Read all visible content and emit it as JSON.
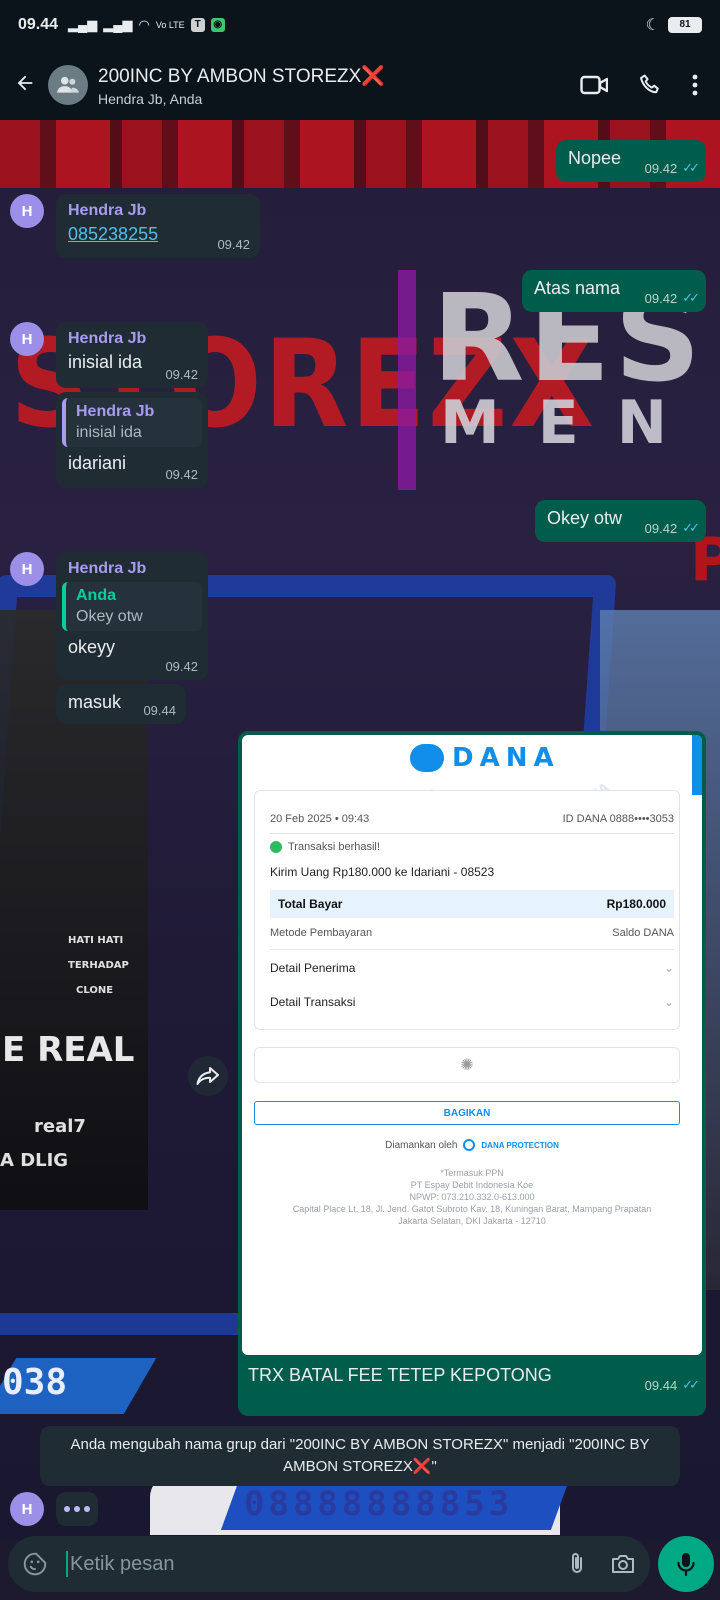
{
  "status_bar": {
    "time": "09.44",
    "network_label": "Vo LTE",
    "battery": "81"
  },
  "header": {
    "title": "200INC BY AMBON STOREZX",
    "title_suffix": "❌",
    "subtitle": "Hendra Jb, Anda"
  },
  "wallpaper": {
    "text_a": "STOREZX",
    "text_b": "RES",
    "text_c": "MEN",
    "photo_caption": "E REAL",
    "photo_small_1": "HATI HATI",
    "photo_small_2": "TERHADAP",
    "photo_small_3": "CLONE",
    "photo_small_4": "real7",
    "photo_small_5": "A DLIG",
    "number_a": "038",
    "number_b": "08888888853",
    "p_letter": "P"
  },
  "messages": {
    "m1": {
      "text": "Nopee",
      "time": "09.42"
    },
    "m2": {
      "sender": "Hendra Jb",
      "link": "085238255",
      "time": "09.42"
    },
    "m3": {
      "text": "Atas nama",
      "time": "09.42"
    },
    "m4": {
      "sender": "Hendra Jb",
      "text": "inisial ida",
      "time": "09.42"
    },
    "m5": {
      "quote_name": "Hendra Jb",
      "quote_text": "inisial ida",
      "text": "idariani",
      "time": "09.42"
    },
    "m6": {
      "text": "Okey otw",
      "time": "09.42"
    },
    "m7": {
      "sender": "Hendra Jb",
      "quote_name": "Anda",
      "quote_text": "Okey otw",
      "text": "okeyy",
      "time": "09.42"
    },
    "m8": {
      "text": "masuk",
      "time": "09.44"
    },
    "m9": {
      "caption": "TRX BATAL FEE TETEP KEPOTONG",
      "time": "09.44"
    }
  },
  "receipt": {
    "brand": "DANA",
    "date": "20 Feb 2025 • 09:43",
    "dana_id": "ID DANA 0888••••3053",
    "status": "Transaksi berhasil!",
    "description": "Kirim Uang Rp180.000 ke Idariani - 08523",
    "total_label": "Total Bayar",
    "total_value": "Rp180.000",
    "method_label": "Metode Pembayaran",
    "method_value": "Saldo DANA",
    "detail_receiver": "Detail Penerima",
    "detail_transaction": "Detail Transaksi",
    "share_label": "BAGIKAN",
    "secured_by": "Diamankan oleh",
    "protection": "DANA PROTECTION",
    "footer_1": "*Termasuk PPN",
    "footer_2": "PT Espay Debit Indonesia Koe",
    "footer_3": "NPWP: 073.210.332.0-613.000",
    "footer_4": "Capital Place Lt. 18, Jl. Jend. Gatot Subroto Kav. 18, Kuningan Barat, Mampang Prapatan",
    "footer_5": "Jakarta Selatan, DKI Jakarta - 12710",
    "watermark": "DANA"
  },
  "system_message": {
    "text": "Anda mengubah nama grup dari \"200INC BY AMBON STOREZX\" menjadi \"200INC BY AMBON STOREZX",
    "suffix_icon": "❌",
    "suffix_quote": "\""
  },
  "avatar_letter": "H",
  "input": {
    "placeholder": "Ketik pesan"
  },
  "colors": {
    "accent": "#00a884",
    "outgoing_bubble": "#005c4b",
    "incoming_bubble": "#1f2c34",
    "sender_name": "#a99bf0",
    "read_ticks": "#53bdeb",
    "dana_blue": "#118eea"
  },
  "icons": [
    "back-arrow-icon",
    "group-avatar-icon",
    "video-call-icon",
    "voice-call-icon",
    "more-options-icon",
    "forward-icon",
    "sticker-icon",
    "attach-icon",
    "camera-icon",
    "mic-icon"
  ]
}
